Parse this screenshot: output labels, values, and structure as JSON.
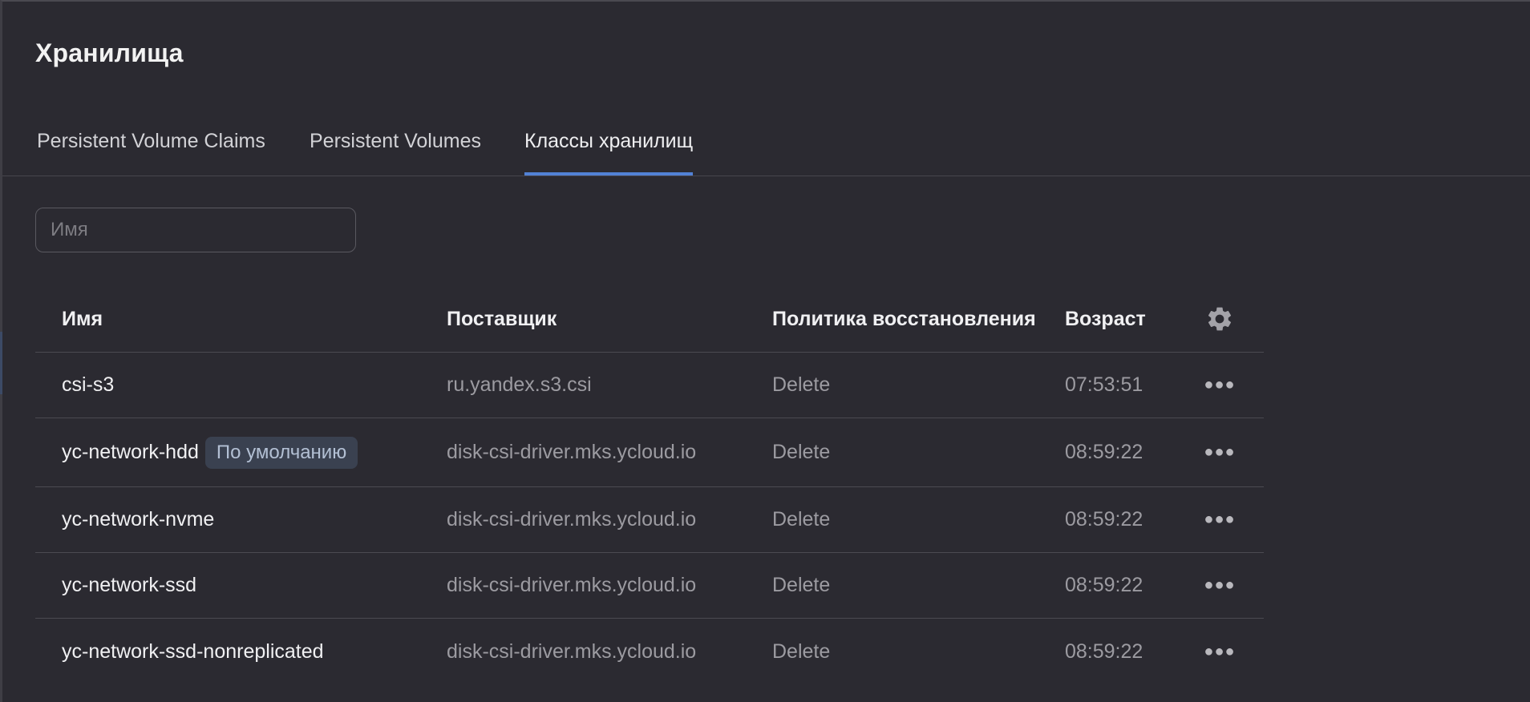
{
  "page": {
    "title": "Хранилища"
  },
  "tabs": [
    {
      "label": "Persistent Volume Claims",
      "active": false
    },
    {
      "label": "Persistent Volumes",
      "active": false
    },
    {
      "label": "Классы хранилищ",
      "active": true
    }
  ],
  "search": {
    "placeholder": "Имя",
    "value": ""
  },
  "table": {
    "columns": {
      "name": "Имя",
      "provisioner": "Поставщик",
      "reclaim_policy": "Политика восстановления",
      "age": "Возраст",
      "settings_icon": "gear-icon"
    },
    "rows": [
      {
        "name": "csi-s3",
        "badge": "",
        "provisioner": "ru.yandex.s3.csi",
        "policy": "Delete",
        "age": "07:53:51",
        "actions_icon": "more-horizontal-icon"
      },
      {
        "name": "yc-network-hdd",
        "badge": "По умолчанию",
        "provisioner": "disk-csi-driver.mks.ycloud.io",
        "policy": "Delete",
        "age": "08:59:22",
        "actions_icon": "more-horizontal-icon"
      },
      {
        "name": "yc-network-nvme",
        "badge": "",
        "provisioner": "disk-csi-driver.mks.ycloud.io",
        "policy": "Delete",
        "age": "08:59:22",
        "actions_icon": "more-horizontal-icon"
      },
      {
        "name": "yc-network-ssd",
        "badge": "",
        "provisioner": "disk-csi-driver.mks.ycloud.io",
        "policy": "Delete",
        "age": "08:59:22",
        "actions_icon": "more-horizontal-icon"
      },
      {
        "name": "yc-network-ssd-nonreplicated",
        "badge": "",
        "provisioner": "disk-csi-driver.mks.ycloud.io",
        "policy": "Delete",
        "age": "08:59:22",
        "actions_icon": "more-horizontal-icon"
      }
    ]
  },
  "colors": {
    "background": "#2b2a31",
    "active_tab_underline": "#5282d6",
    "badge_bg": "#3a4150",
    "badge_text": "#b3c0d4"
  }
}
